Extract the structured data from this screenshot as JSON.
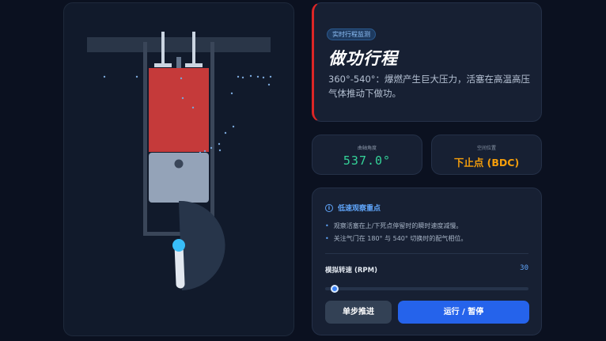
{
  "stroke": {
    "badge": "实时行程监测",
    "title": "做功行程",
    "description": "360°-540°：爆燃产生巨大压力，活塞在高温高压气体推动下做功。",
    "accent_color": "#dc2626"
  },
  "stats": {
    "angle_label": "曲轴角度",
    "angle_value": "537.0°",
    "position_label": "空间位置",
    "position_value": "下止点 (BDC)"
  },
  "tips": {
    "title": "低速观察重点",
    "items": [
      "观察活塞在上/下死点停留时的瞬时速度减慢。",
      "关注气门在 180° 与 540° 切换时的配气相位。"
    ]
  },
  "rpm": {
    "label": "模拟转速 (RPM)",
    "value": "30",
    "fraction": 0.03
  },
  "buttons": {
    "step": "单步推进",
    "run": "运行 / 暂停"
  },
  "engine": {
    "combustion_color": "#c53a3a",
    "piston_color": "#94a3b8",
    "crank_pin_color": "#38bdf8",
    "icons": [
      "info-icon"
    ]
  }
}
